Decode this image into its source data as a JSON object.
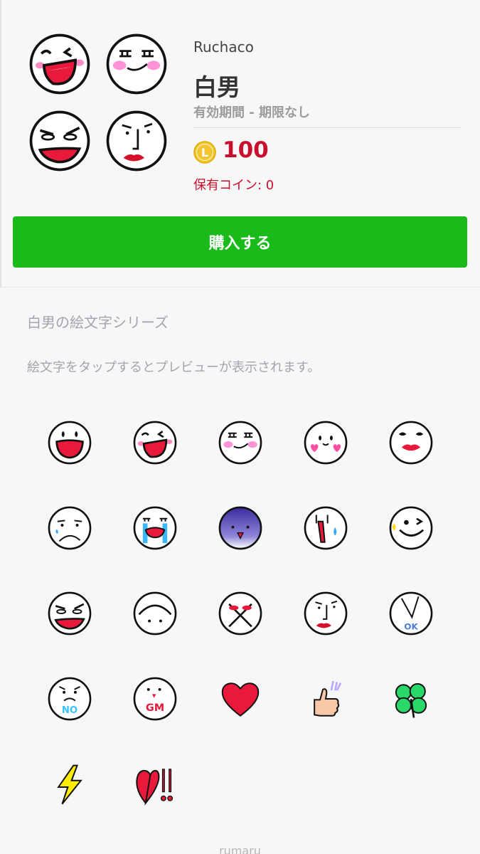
{
  "product": {
    "author": "Ruchaco",
    "title": "白男",
    "validity": "有効期間 - 期限なし",
    "coin_symbol": "L",
    "price": "100",
    "owned": "保有コイン: 0"
  },
  "buy_button": {
    "label": "購入する"
  },
  "series_link": "白男の絵文字シリーズ",
  "preview_hint": "絵文字をタップするとプレビューが表示されます。",
  "emoji_badges": {
    "ok": "OK",
    "no": "NO",
    "gm": "GM"
  },
  "footer_text": "rumaru",
  "colors": {
    "buy_green": "#1aba1a",
    "price_red": "#c8102e",
    "coin_gold": "#f2c530"
  }
}
